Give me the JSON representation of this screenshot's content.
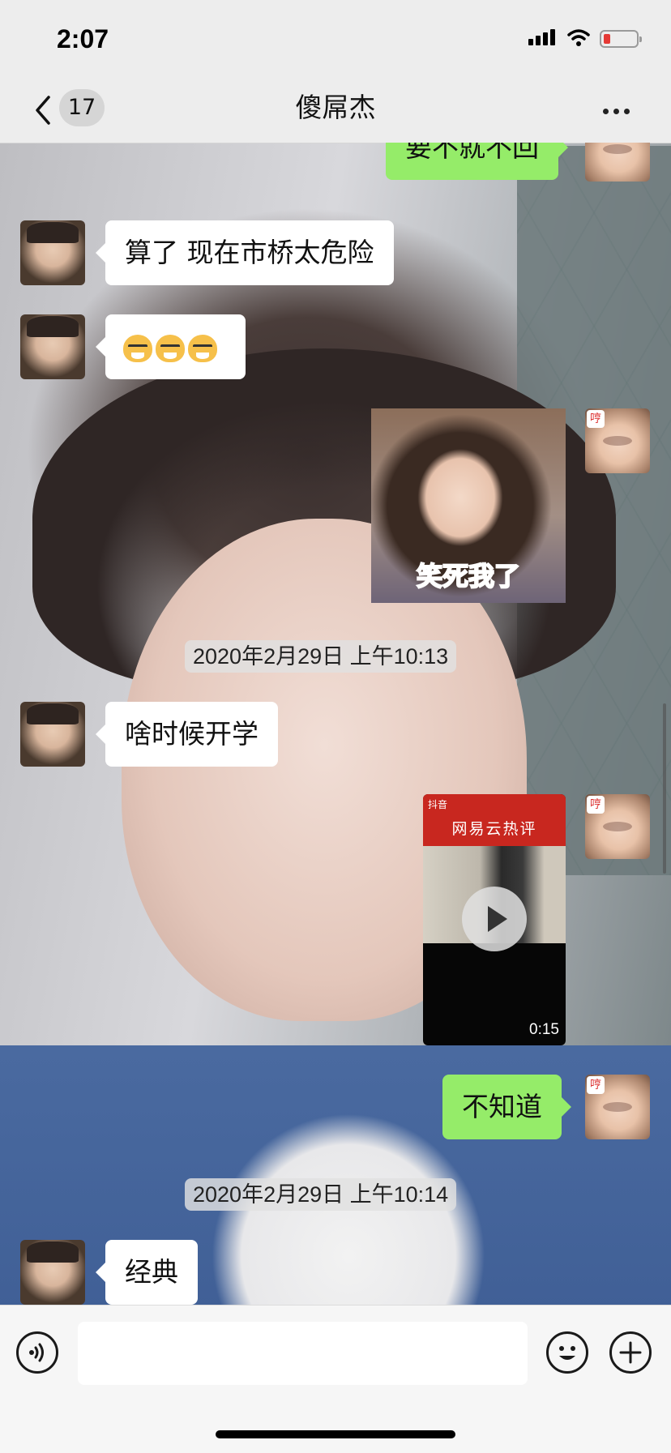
{
  "status_bar": {
    "time": "2:07",
    "battery_level": 0.2,
    "signal_icon": "signal-bars-icon",
    "wifi_icon": "wifi-icon",
    "battery_icon": "battery-low-icon"
  },
  "nav": {
    "back_icon": "chevron-left-icon",
    "unread_count": "17",
    "title": "傻屌杰",
    "more_icon": "ellipsis-icon"
  },
  "messages": [
    {
      "type": "text",
      "from": "self",
      "text": "要不就不回"
    },
    {
      "type": "text",
      "from": "other",
      "text": "算了  现在市桥太危险"
    },
    {
      "type": "emoji",
      "from": "other",
      "emoji": [
        "cat-face-emoji",
        "cat-face-emoji",
        "cat-face-emoji"
      ]
    },
    {
      "type": "sticker",
      "from": "self",
      "caption": "笑死我了"
    },
    {
      "type": "timestamp",
      "text": "2020年2月29日 上午10:13"
    },
    {
      "type": "text",
      "from": "other",
      "text": "啥时候开学"
    },
    {
      "type": "video",
      "from": "self",
      "app_label": "抖音",
      "headline": "网易云热评",
      "duration": "0:15"
    },
    {
      "type": "text",
      "from": "self",
      "text": "不知道"
    },
    {
      "type": "timestamp",
      "text": "2020年2月29日 上午10:14"
    },
    {
      "type": "text",
      "from": "other",
      "text": "经典"
    }
  ],
  "self_avatar_badge": "哼",
  "input": {
    "placeholder": "",
    "value": ""
  },
  "toolbar": {
    "voice_icon": "voice-icon",
    "emoji_icon": "smiley-icon",
    "plus_icon": "plus-circle-icon"
  },
  "colors": {
    "outgoing_bubble": "#95ec69",
    "incoming_bubble": "#ffffff",
    "bar_background": "#ededed",
    "battery_low": "#e53935"
  }
}
